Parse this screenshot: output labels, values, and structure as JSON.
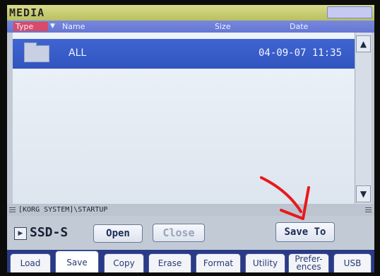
{
  "window": {
    "title": "MEDIA"
  },
  "header": {
    "columns": [
      "Type",
      "Name",
      "Size",
      "Date"
    ],
    "sort_marker": "▼"
  },
  "files": [
    {
      "name": "ALL",
      "size": "",
      "date": "04-09-07 11:35"
    }
  ],
  "scrollbar": {
    "up_glyph": "▲",
    "down_glyph": "▼"
  },
  "path": {
    "current": "[KORG SYSTEM]\\STARTUP"
  },
  "drive": {
    "label": "SSD-S",
    "arrow_glyph": "▶"
  },
  "buttons": {
    "open": "Open",
    "close": "Close",
    "save_to": "Save To"
  },
  "tabs": [
    {
      "label": "Load",
      "active": false
    },
    {
      "label": "Save",
      "active": true
    },
    {
      "label": "Copy",
      "active": false
    },
    {
      "label": "Erase",
      "active": false
    },
    {
      "label": "Format",
      "active": false
    },
    {
      "label": "Utility",
      "active": false
    },
    {
      "label": "Prefer-ences",
      "active": false
    },
    {
      "label": "USB",
      "active": false
    }
  ],
  "colors": {
    "title_bar": "#c8cd70",
    "header": "#6d7fd8",
    "selected_row": "#3a5fcd",
    "annotation_arrow": "#e8191e"
  }
}
